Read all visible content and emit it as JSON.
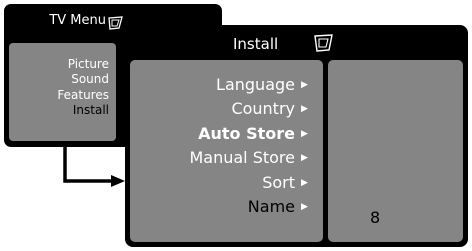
{
  "tv_menu": {
    "title": "TV Menu",
    "icon": "tv-menu-icon",
    "items": [
      "Picture",
      "Sound",
      "Features",
      "Install"
    ],
    "active_index": 3
  },
  "install_menu": {
    "title": "Install",
    "icon": "install-icon",
    "items": [
      {
        "label": "Language"
      },
      {
        "label": "Country"
      },
      {
        "label": "Auto Store"
      },
      {
        "label": "Manual Store"
      },
      {
        "label": "Sort"
      },
      {
        "label": "Name"
      }
    ],
    "arrow_glyph": "▶",
    "value": "8"
  },
  "colors": {
    "window_bg": "#000000",
    "panel_bg": "#858585",
    "text_light": "#ffffff",
    "text_dark": "#000000"
  }
}
